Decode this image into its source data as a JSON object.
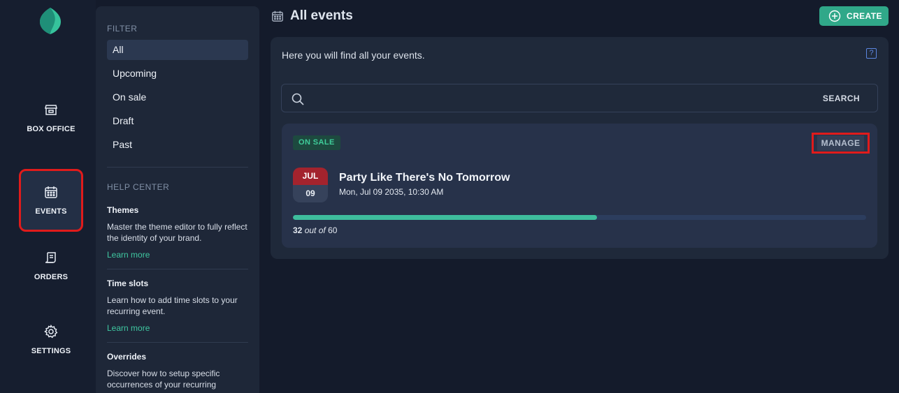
{
  "sidebar": {
    "items": [
      {
        "label": "BOX OFFICE",
        "icon": "storefront-icon",
        "active": false
      },
      {
        "label": "EVENTS",
        "icon": "calendar-icon",
        "active": true
      },
      {
        "label": "ORDERS",
        "icon": "receipt-icon",
        "active": false
      },
      {
        "label": "SETTINGS",
        "icon": "gear-icon",
        "active": false
      }
    ]
  },
  "filter": {
    "heading": "FILTER",
    "options": [
      "All",
      "Upcoming",
      "On sale",
      "Draft",
      "Past"
    ],
    "selected": "All"
  },
  "help_center": {
    "heading": "HELP CENTER",
    "articles": [
      {
        "title": "Themes",
        "description": "Master the theme editor to fully reflect the identity of your brand.",
        "link": "Learn more"
      },
      {
        "title": "Time slots",
        "description": "Learn how to add time slots to your recurring event.",
        "link": "Learn more"
      },
      {
        "title": "Overrides",
        "description": "Discover how to setup specific occurrences of your recurring",
        "link": ""
      }
    ]
  },
  "header": {
    "title": "All events",
    "create_label": "CREATE"
  },
  "main": {
    "intro": "Here you will find all your events.",
    "help_icon": "?",
    "search": {
      "value": "",
      "placeholder": "",
      "button_label": "SEARCH"
    }
  },
  "events": [
    {
      "status": "ON SALE",
      "manage_label": "MANAGE",
      "month": "JUL",
      "day": "09",
      "title": "Party Like There's No Tomorrow",
      "datetime": "Mon, Jul 09 2035, 10:30 AM",
      "sold": "32",
      "out_of": "out of",
      "capacity": "60",
      "progress_fraction": 0.53
    }
  ],
  "colors": {
    "accent": "#30a889",
    "background": "#141b2b",
    "panel": "#1e2738",
    "highlight": "#e01b1b",
    "badge_green": "#3fcd9a",
    "month_red": "#a3232d"
  }
}
